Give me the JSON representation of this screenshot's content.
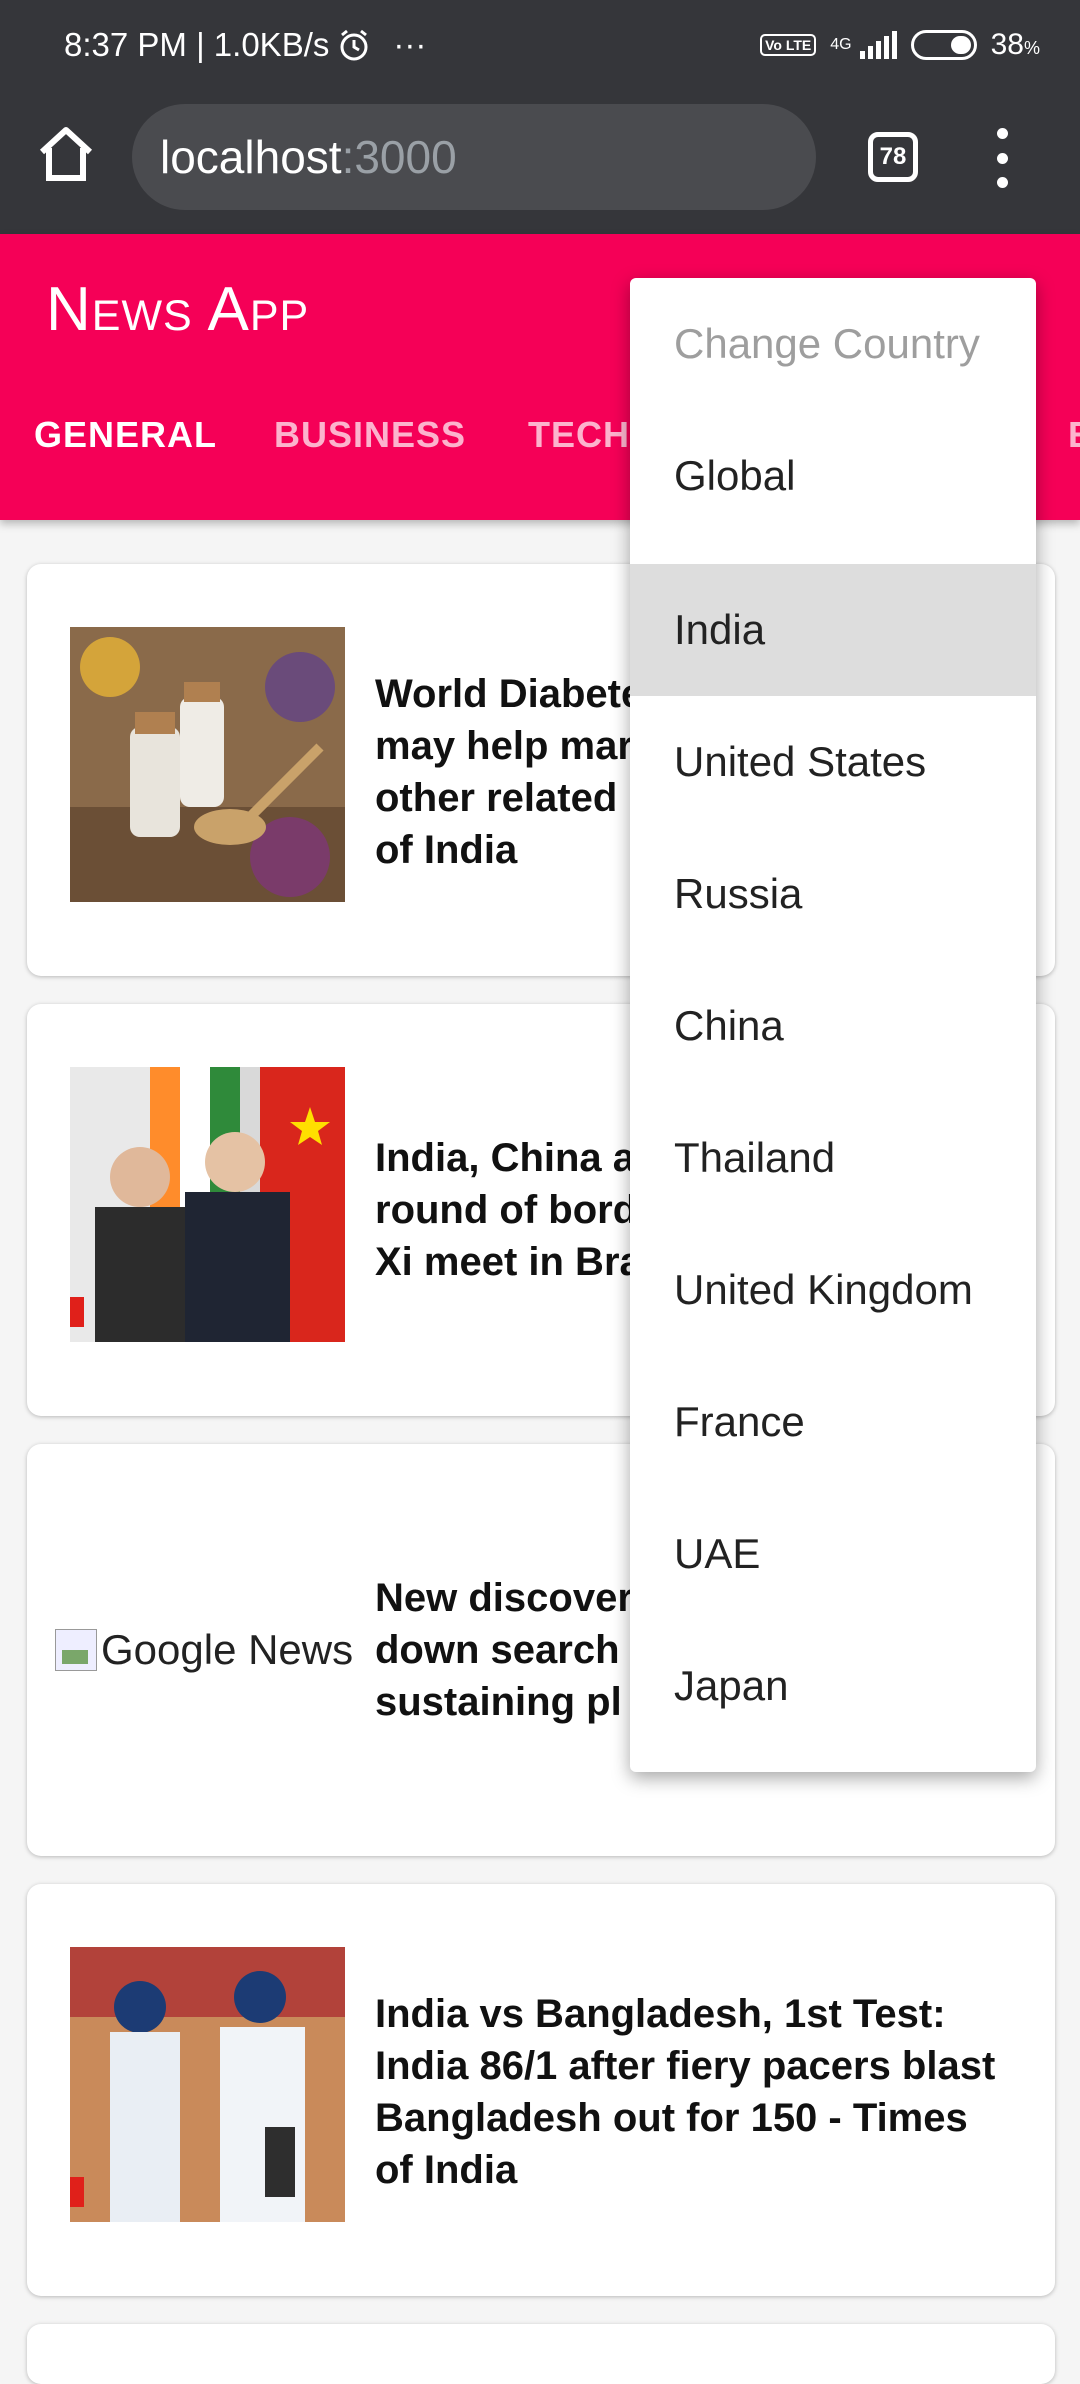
{
  "status_bar": {
    "time_speed": "8:37 PM | 1.0KB/s",
    "dots": "···",
    "network": "4G",
    "volte": "Vo LTE",
    "battery": "38"
  },
  "browser": {
    "url_host": "localhost",
    "url_port": ":3000",
    "tab_count": "78"
  },
  "app": {
    "title": "News App",
    "tabs": [
      {
        "label": "GENERAL",
        "active": true
      },
      {
        "label": "BUSINESS",
        "active": false
      },
      {
        "label": "TECH",
        "active": false
      },
      {
        "label": "E",
        "active": false
      }
    ]
  },
  "articles": [
    {
      "headline": [
        "World Diabete",
        "may help mar",
        "other related",
        "of India"
      ],
      "image": "homeopathy-bottles"
    },
    {
      "headline": [
        "India, China a",
        "round of bord",
        "Xi meet in Bra"
      ],
      "image": "leaders-handshake"
    },
    {
      "headline": [
        "New discover",
        "down search",
        "sustaining pl"
      ],
      "image_alt": "Google News"
    },
    {
      "headline": [
        "India vs Bangladesh, 1st Test:",
        "India 86/1 after fiery pacers blast",
        "Bangladesh out for 150 - Times",
        "of India"
      ],
      "image": "cricketers"
    }
  ],
  "country_menu": {
    "header": "Change Country",
    "items": [
      "Global",
      "India",
      "United States",
      "Russia",
      "China",
      "Thailand",
      "United Kingdom",
      "France",
      "UAE",
      "Japan"
    ],
    "selected": "India"
  },
  "colors": {
    "accent": "#f50057",
    "chrome": "#35363a"
  }
}
